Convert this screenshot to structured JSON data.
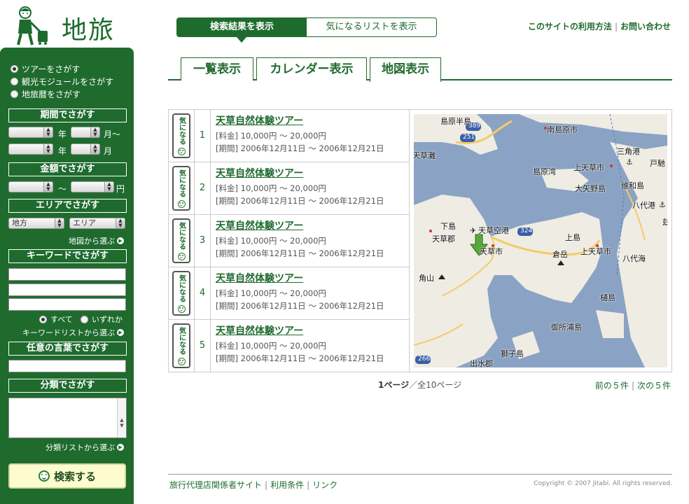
{
  "logo": {
    "text": "地旅"
  },
  "sidebar": {
    "search_types": [
      {
        "label": "ツアーをさがす",
        "selected": true
      },
      {
        "label": "観光モジュールをさがす",
        "selected": false
      },
      {
        "label": "地旅暦をさがす",
        "selected": false
      }
    ],
    "period": {
      "heading": "期間でさがす",
      "year_label": "年",
      "month_label_from": "月〜",
      "month_label_to": "月"
    },
    "price": {
      "heading": "金額でさがす",
      "sep": "〜",
      "unit": "円"
    },
    "area": {
      "heading": "エリアでさがす",
      "region_select": "地方",
      "area_select": "エリア",
      "map_link": "地図から選ぶ"
    },
    "keyword": {
      "heading": "キーワードでさがす",
      "all_label": "すべて",
      "any_label": "いずれか",
      "list_link": "キーワードリストから選ぶ"
    },
    "freeword": {
      "heading": "任意の言葉でさがす"
    },
    "category": {
      "heading": "分類でさがす",
      "list_link": "分類リストから選ぶ"
    },
    "search_button": "検索する"
  },
  "header": {
    "tabs": [
      {
        "label": "検索結果を表示",
        "active": true
      },
      {
        "label": "気になるリストを表示",
        "active": false
      }
    ],
    "links": [
      "このサイトの利用方法",
      "お問い合わせ"
    ]
  },
  "view_tabs": [
    {
      "label": "一覧表示",
      "active": false
    },
    {
      "label": "カレンダー表示",
      "active": false
    },
    {
      "label": "地図表示",
      "active": true
    }
  ],
  "results": [
    {
      "num": "1",
      "title": "天草自然体験ツアー",
      "price": "[料金] 10,000円 〜 20,000円",
      "period": "[期間] 2006年12月11日 〜 2006年12月21日"
    },
    {
      "num": "2",
      "title": "天草自然体験ツアー",
      "price": "[料金] 10,000円 〜 20,000円",
      "period": "[期間] 2006年12月11日 〜 2006年12月21日"
    },
    {
      "num": "3",
      "title": "天草自然体験ツアー",
      "price": "[料金] 10,000円 〜 20,000円",
      "period": "[期間] 2006年12月11日 〜 2006年12月21日"
    },
    {
      "num": "4",
      "title": "天草自然体験ツアー",
      "price": "[料金] 10,000円 〜 20,000円",
      "period": "[期間] 2006年12月11日 〜 2006年12月21日"
    },
    {
      "num": "5",
      "title": "天草自然体験ツアー",
      "price": "[料金] 10,000円 〜 20,000円",
      "period": "[期間] 2006年12月11日 〜 2006年12月21日"
    }
  ],
  "kininaru_label": "気になる",
  "map": {
    "labels": [
      "島原半島",
      "南島原市",
      "天草灘",
      "島原湾",
      "上天草市",
      "三角港",
      "戸馳",
      "大矢野島",
      "維和島",
      "八代港",
      "下島",
      "天草空港",
      "天草郡",
      "天草市",
      "上島",
      "倉岳",
      "上天草市",
      "八代海",
      "角山",
      "樋島",
      "御所浦島",
      "獅子島",
      "出水郡",
      "玆"
    ],
    "roads": [
      "389",
      "251",
      "324",
      "266"
    ]
  },
  "pager": {
    "current": "1ページ",
    "rest": "／全10ページ",
    "prev": "前の５件",
    "next": "次の５件"
  },
  "footer": {
    "links": [
      "旅行代理店関係者サイト",
      "利用条件",
      "リンク"
    ],
    "copyright": "Copyright © 2007 Jitabi. All rights reserved."
  },
  "colors": {
    "brand": "#1f6b2e",
    "map_sea": "#8aa3c4",
    "map_land": "#efece3"
  }
}
